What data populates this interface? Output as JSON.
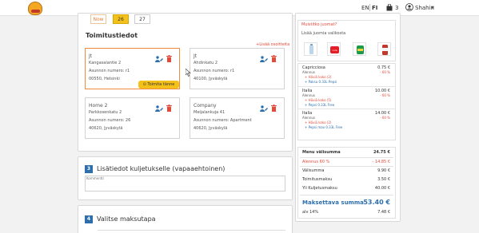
{
  "header": {
    "lang_en": "EN",
    "lang_fi": "FI",
    "cart_count": "3",
    "user_name": "Shahin",
    "accent_color": "#f4c01a"
  },
  "dates": {
    "now": "Now",
    "d26": "26",
    "d27": "27"
  },
  "delivery": {
    "title": "Toimitustiedot",
    "add_address": "+Lisää osoitteita",
    "cards": [
      {
        "name": "Jt",
        "line1": "Kangasalantie 2",
        "line2": "Asunnon numero: r1",
        "line3": "00550, Helsinki",
        "deliver_label": "Toimita tänne"
      },
      {
        "name": "Jt",
        "line1": "Ahdinkatu 2",
        "line2": "Asunnon numero: r1",
        "line3": "40100, Jyväskylä"
      },
      {
        "name": "Home 2",
        "line1": "Parkkosenkatu 2",
        "line2": "Asunnon numero: 26",
        "line3": "40620, Jyväskylä"
      },
      {
        "name": "Company",
        "line1": "Meijalankuja 41",
        "line2": "Asunnon numero: Apartment",
        "line3": "40620, Jyväskylä"
      }
    ]
  },
  "step3": {
    "number": "3",
    "title": "Lisätiedot kuljetukselle (vapaaehtoinen)",
    "comment_label": "Kommentti"
  },
  "step4": {
    "number": "4",
    "title": "Valitse maksutapa"
  },
  "drinks": {
    "title": "Muistitko juomat?",
    "subtitle": "Lisää juomia valikosta",
    "icons": [
      "water-bottle",
      "coca-cola",
      "sprite",
      "soda-can"
    ]
  },
  "items": [
    {
      "name": "Capricciosa",
      "price": "0.75 €",
      "sub": "Alennus",
      "disc": "- 60 %",
      "extras": [
        {
          "text": "+ Häviä koko (2)",
          "blue": false
        },
        {
          "text": "+ Paksu 0.33L Pepsi",
          "blue": true
        }
      ]
    },
    {
      "name": "Italia",
      "price": "10.00 €",
      "sub": "Alennus",
      "disc": "- 60 %",
      "extras": [
        {
          "text": "+ Häviä koko (5)",
          "blue": false
        },
        {
          "text": "+ Pepsi 0.33L Free",
          "blue": true
        }
      ]
    },
    {
      "name": "Italia",
      "price": "14.00 €",
      "sub": "Alennus",
      "disc": "- 60 %",
      "extras": [
        {
          "text": "+ Häviä koko (2)",
          "blue": false
        },
        {
          "text": "+ Pepsi max 0.33L Free",
          "blue": true
        }
      ]
    }
  ],
  "summary": {
    "menu_label": "Menu välisumma",
    "menu_value": "24.75 €",
    "discount_label": "Alennus 60 %",
    "discount_value": "- 14.85 €",
    "subtotal_label": "Välisumma",
    "subtotal_value": "9.90 €",
    "delivery_label": "Toimitusmaksu",
    "delivery_value": "3.50 €",
    "small_label": "Yli Kuljetusmaksu",
    "small_value": "40.00 €",
    "total_label": "Maksettava summa",
    "total_value": "53.40 €",
    "vat_label": "alv 14%",
    "vat_value": "7.48 €"
  }
}
